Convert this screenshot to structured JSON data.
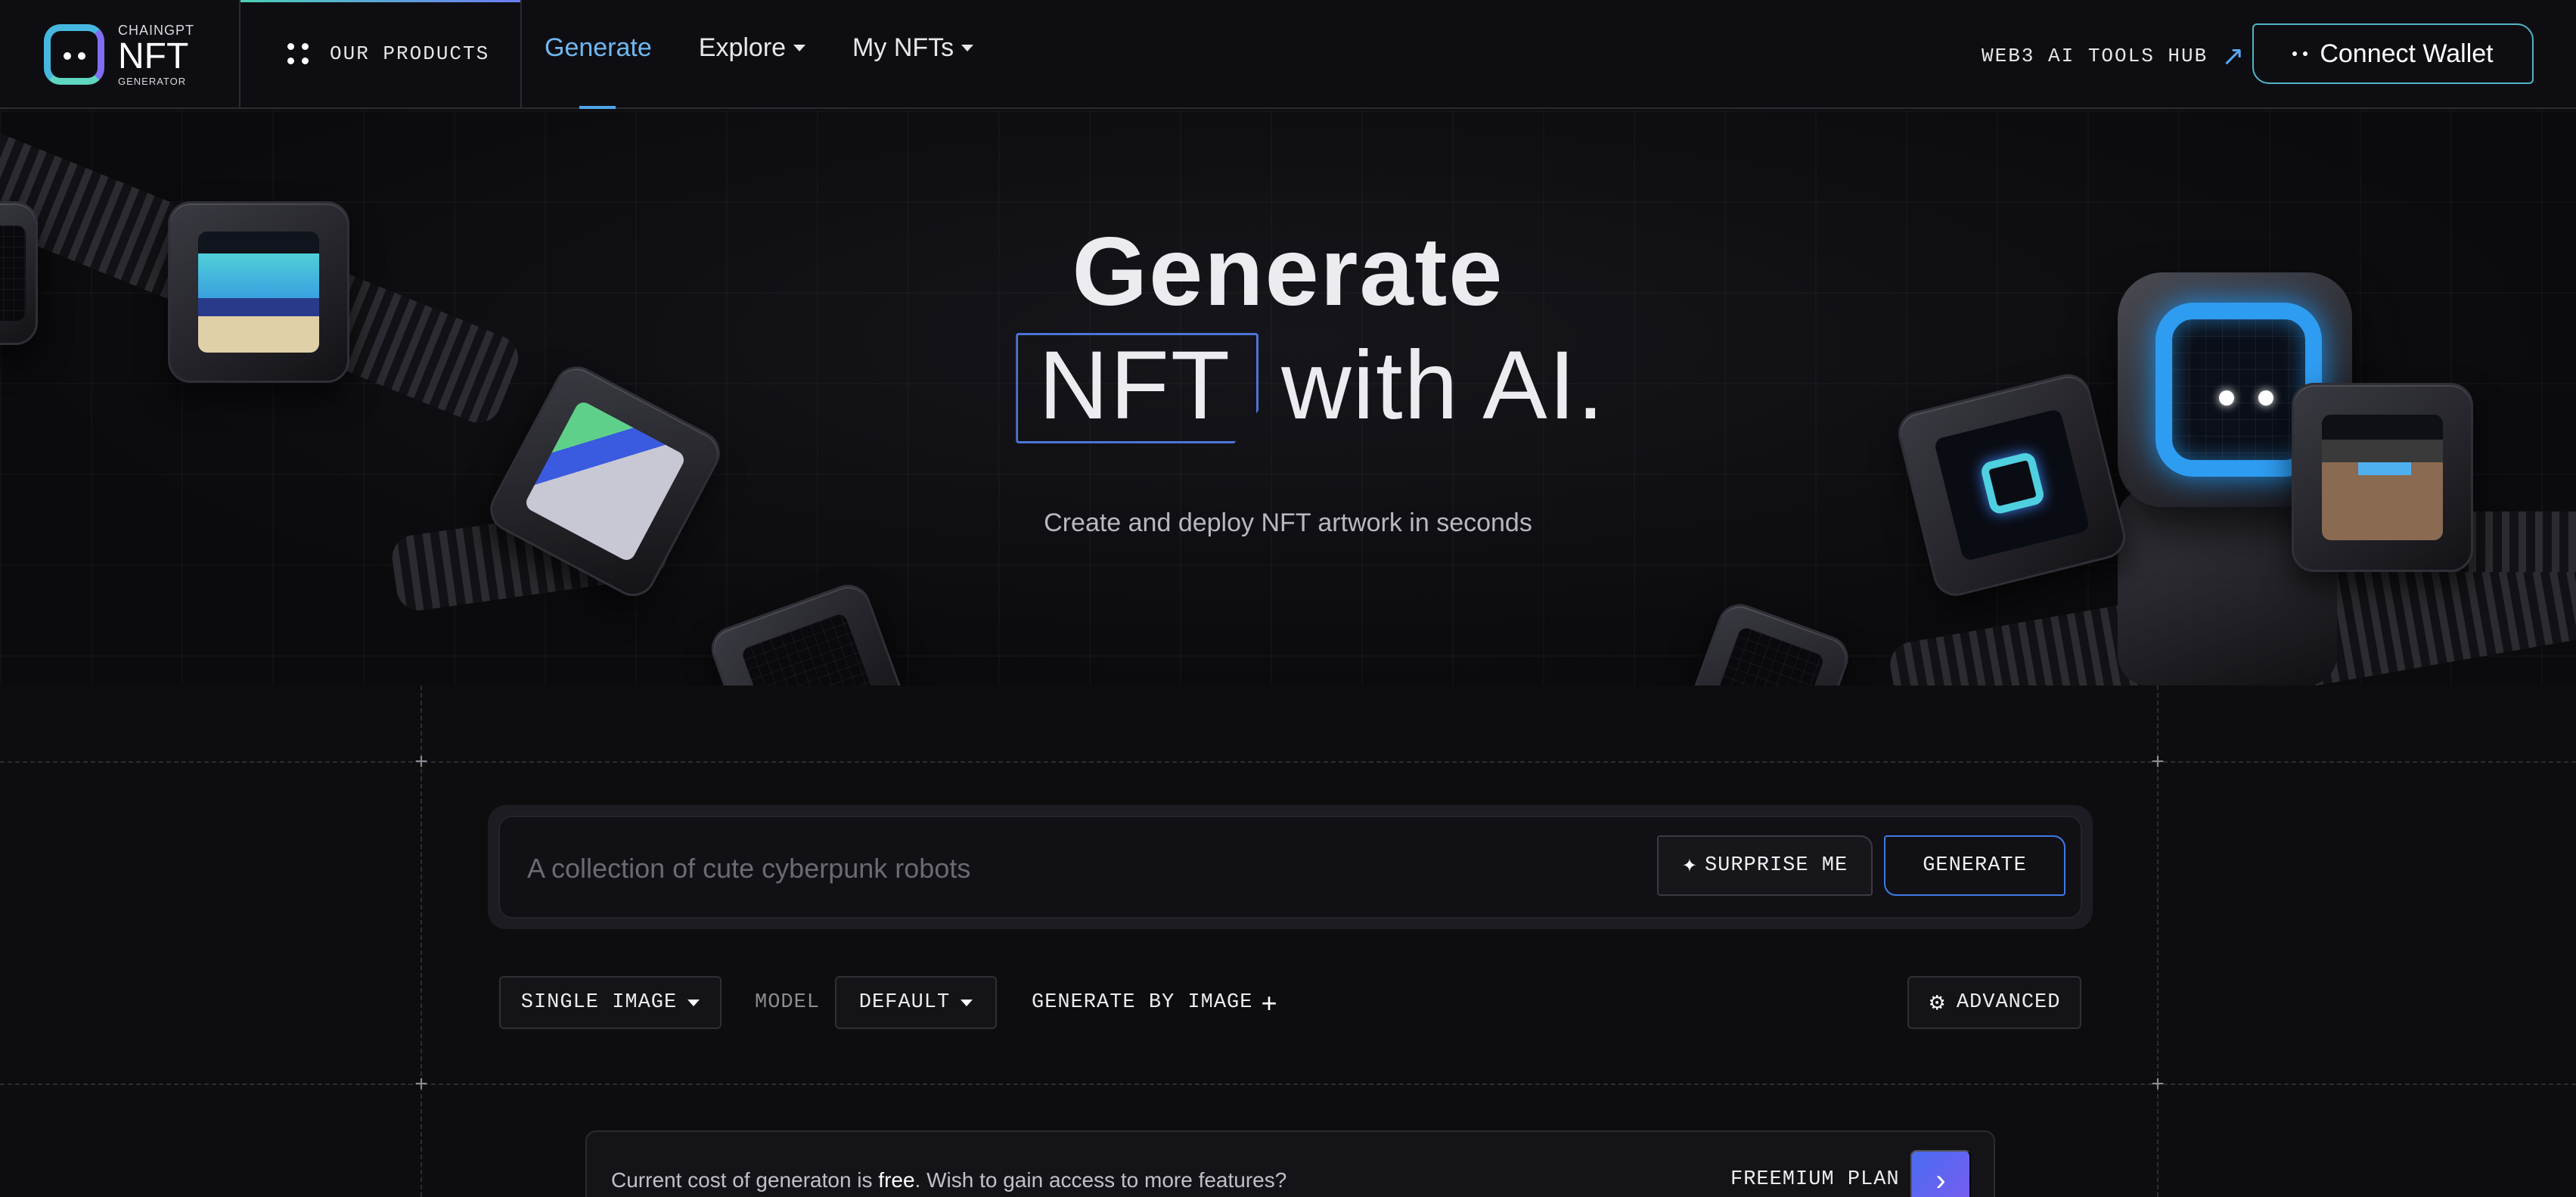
{
  "brand": {
    "line1": "CHAINGPT",
    "line2": "NFT",
    "line3": "GENERATOR",
    "accent": "#4fb5c8",
    "gradient": [
      "#4ad0b8",
      "#6c7cf5"
    ]
  },
  "nav": {
    "products_label": "OUR PRODUCTS",
    "links": [
      {
        "label": "Generate",
        "active": true
      },
      {
        "label": "Explore",
        "dropdown": true
      },
      {
        "label": "My NFTs",
        "dropdown": true
      }
    ],
    "hub_label": "WEB3 AI TOOLS HUB",
    "connect_label": "Connect Wallet"
  },
  "hero": {
    "title_line1": "Generate",
    "title_highlight": "NFT",
    "title_rest": "with AI.",
    "subtitle": "Create and deploy NFT artwork in seconds"
  },
  "prompt": {
    "placeholder": "A collection of cute cyberpunk robots",
    "value": "",
    "surprise_label": "SURPRISE ME",
    "generate_label": "GENERATE"
  },
  "options": {
    "image_mode": "SINGLE IMAGE",
    "model_label": "MODEL",
    "model_value": "DEFAULT",
    "generate_by_image_label": "GENERATE BY IMAGE",
    "advanced_label": "ADVANCED"
  },
  "plan": {
    "cost_prefix": "Current cost of generaton is ",
    "cost_value": "free",
    "cost_suffix": ". Wish to gain access to more features?",
    "plan_label": "FREEMIUM PLAN"
  },
  "icons": {
    "products": "grid-dots-icon",
    "hub": "arrow-up-right-icon",
    "connect": "two-dots-icon",
    "surprise": "magic-wand-icon",
    "advanced": "gear-icon",
    "plan_go": "chevron-right-icon"
  }
}
